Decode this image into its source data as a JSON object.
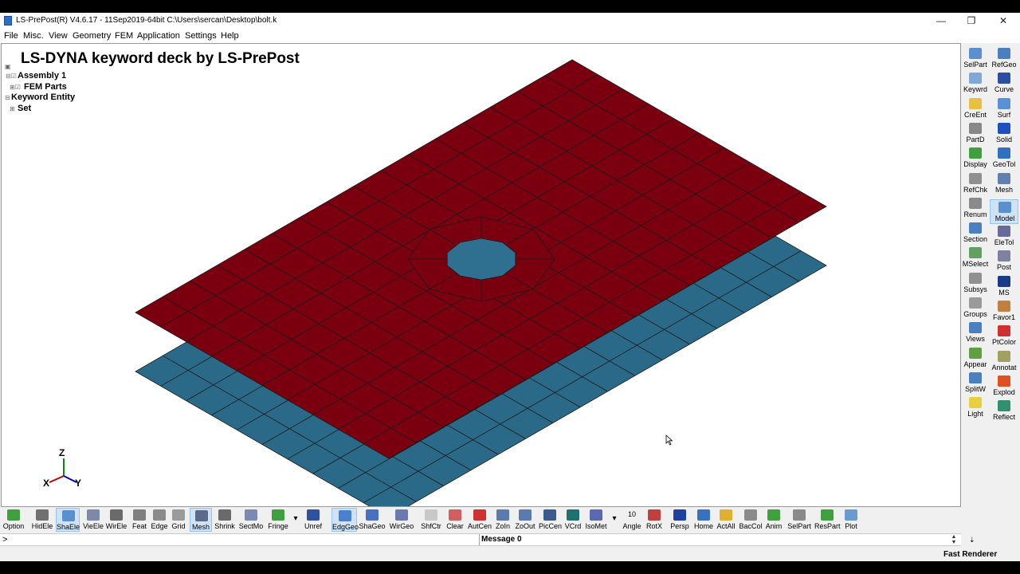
{
  "window": {
    "title": "LS-PrePost(R) V4.6.17 - 11Sep2019-64bit C:\\Users\\sercan\\Desktop\\bolt.k",
    "minimize_glyph": "—",
    "restore_glyph": "❐",
    "close_glyph": "✕"
  },
  "menu": [
    "File",
    "Misc.",
    "View",
    "Geometry",
    "FEM",
    "Application",
    "Settings",
    "Help"
  ],
  "viewport": {
    "title": "LS-DYNA keyword deck by LS-PrePost",
    "tree": [
      {
        "label": "Assembly 1"
      },
      {
        "label": "FEM Parts"
      },
      {
        "label": "Keyword Entity"
      },
      {
        "label": "Set"
      }
    ],
    "triad": {
      "z": "Z",
      "x": "X",
      "y": "Y"
    },
    "colors": {
      "top_plate": "#7a0010",
      "bottom_plate": "#2a6a88",
      "hole": "#2f7090",
      "mesh_line": "#1a1a1a"
    }
  },
  "right_panel": [
    {
      "label": "SelPart",
      "icon": "select-part-icon",
      "color": "#5a8fd0"
    },
    {
      "label": "RefGeo",
      "icon": "ref-geo-icon",
      "color": "#4a7fc0"
    },
    {
      "label": "Keywrd",
      "icon": "keyword-icon",
      "color": "#7fa7d8"
    },
    {
      "label": "Curve",
      "icon": "curve-icon",
      "color": "#2a4fa0"
    },
    {
      "label": "CreEnt",
      "icon": "create-entity-icon",
      "color": "#e8c040"
    },
    {
      "label": "Surf",
      "icon": "surface-icon",
      "color": "#5a90d8"
    },
    {
      "label": "PartD",
      "icon": "part-data-icon",
      "color": "#888888"
    },
    {
      "label": "Solid",
      "icon": "solid-icon",
      "color": "#2050c0"
    },
    {
      "label": "Display",
      "icon": "display-icon",
      "color": "#40a040"
    },
    {
      "label": "GeoTol",
      "icon": "geo-tool-icon",
      "color": "#3070c0"
    },
    {
      "label": "RefChk",
      "icon": "reference-check-icon",
      "color": "#909090"
    },
    {
      "label": "Mesh",
      "icon": "mesh-icon",
      "color": "#6080b0"
    },
    {
      "label": "Renum",
      "icon": "renumber-icon",
      "color": "#8a8a8a"
    },
    {
      "label": "Model",
      "icon": "model-icon",
      "color": "#5a8fd0"
    },
    {
      "label": "Section",
      "icon": "section-icon",
      "color": "#4a80c0"
    },
    {
      "label": "EleTol",
      "icon": "element-tool-icon",
      "color": "#6a6a9a"
    },
    {
      "label": "MSelect",
      "icon": "multi-select-icon",
      "color": "#60a060"
    },
    {
      "label": "Post",
      "icon": "post-icon",
      "color": "#8080a0"
    },
    {
      "label": "Subsys",
      "icon": "subsystem-icon",
      "color": "#909090"
    },
    {
      "label": "MS",
      "icon": "ms-icon",
      "color": "#1a3a8a"
    },
    {
      "label": "Groups",
      "icon": "groups-icon",
      "color": "#9a9a9a"
    },
    {
      "label": "Favor1",
      "icon": "favorite-icon",
      "color": "#c08040"
    },
    {
      "label": "Views",
      "icon": "views-icon",
      "color": "#4a7fc0"
    },
    {
      "label": "PtColor",
      "icon": "part-color-icon",
      "color": "#d03030"
    },
    {
      "label": "Appear",
      "icon": "appearance-icon",
      "color": "#60a040"
    },
    {
      "label": "Annotat",
      "icon": "annotation-icon",
      "color": "#a0a060"
    },
    {
      "label": "SplitW",
      "icon": "split-window-icon",
      "color": "#4a7fc0"
    },
    {
      "label": "Explod",
      "icon": "explode-icon",
      "color": "#e05020"
    },
    {
      "label": "Light",
      "icon": "light-icon",
      "color": "#e8d040"
    },
    {
      "label": "Reflect",
      "icon": "reflect-icon",
      "color": "#309070"
    }
  ],
  "right_panel_more": "⇣",
  "bottom_toolbar": [
    {
      "label": "Option",
      "icon": "option-icon",
      "color": "#40a040"
    },
    {
      "label": "HidEle",
      "icon": "hide-element-icon",
      "color": "#707070"
    },
    {
      "label": "ShaEle",
      "icon": "shade-element-icon",
      "color": "#5a8fd0"
    },
    {
      "label": "VieEle",
      "icon": "view-element-icon",
      "color": "#7a8aa8"
    },
    {
      "label": "WirEle",
      "icon": "wire-element-icon",
      "color": "#6a6a6a"
    },
    {
      "label": "Feat",
      "icon": "feature-icon",
      "color": "#808080"
    },
    {
      "label": "Edge",
      "icon": "edge-icon",
      "color": "#8a8a8a"
    },
    {
      "label": "Grid",
      "icon": "grid-icon",
      "color": "#9a9a9a"
    },
    {
      "label": "Mesh",
      "icon": "mesh-icon",
      "color": "#5a6a8a"
    },
    {
      "label": "Shrink",
      "icon": "shrink-icon",
      "color": "#6a6a6a"
    },
    {
      "label": "SectMo",
      "icon": "section-model-icon",
      "color": "#7a8ab0"
    },
    {
      "label": "Fringe",
      "icon": "fringe-icon",
      "color": "#40a040"
    },
    {
      "label": "▾",
      "icon": "dropdown-arrow-icon",
      "color": "#f0f0f0"
    },
    {
      "label": "Unref",
      "icon": "unreferenced-icon",
      "color": "#3050a0"
    },
    {
      "label": "EdgGeo",
      "icon": "edge-geometry-icon",
      "color": "#4a80d0"
    },
    {
      "label": "ShaGeo",
      "icon": "shade-geometry-icon",
      "color": "#4a70c0"
    },
    {
      "label": "WirGeo",
      "icon": "wire-geometry-icon",
      "color": "#6a7ab0"
    },
    {
      "label": "ShfCtr",
      "icon": "shift-ctrl-icon",
      "color": "#c8c8c8"
    },
    {
      "label": "Clear",
      "icon": "clear-icon",
      "color": "#d06060"
    },
    {
      "label": "AutCen",
      "icon": "auto-center-icon",
      "color": "#d03030"
    },
    {
      "label": "ZoIn",
      "icon": "zoom-in-icon",
      "color": "#5a7ab0"
    },
    {
      "label": "ZoOut",
      "icon": "zoom-out-icon",
      "color": "#5a7ab0"
    },
    {
      "label": "PicCen",
      "icon": "pick-center-icon",
      "color": "#3a5a90"
    },
    {
      "label": "VCrd",
      "icon": "view-coordinate-icon",
      "color": "#207070"
    },
    {
      "label": "IsoMet",
      "icon": "isometric-icon",
      "color": "#5a6ab0"
    },
    {
      "label": "▾",
      "icon": "dropdown-arrow-icon",
      "color": "#f0f0f0"
    },
    {
      "label": "Angle",
      "icon": "angle-value-icon",
      "color": "#f0f0f0",
      "value": "10"
    },
    {
      "label": "RotX",
      "icon": "rotate-x-icon",
      "color": "#c04040"
    },
    {
      "label": "Persp",
      "icon": "perspective-icon",
      "color": "#2040a0"
    },
    {
      "label": "Home",
      "icon": "home-icon",
      "color": "#3a70c0"
    },
    {
      "label": "ActAll",
      "icon": "activate-all-icon",
      "color": "#e0b030"
    },
    {
      "label": "BacCol",
      "icon": "background-color-icon",
      "color": "#8a8a8a"
    },
    {
      "label": "Anim",
      "icon": "animation-icon",
      "color": "#40a040"
    },
    {
      "label": "SelPart",
      "icon": "select-part-icon",
      "color": "#8a8a8a"
    },
    {
      "label": "ResPart",
      "icon": "reset-part-icon",
      "color": "#40a040"
    },
    {
      "label": "Plot",
      "icon": "plot-icon",
      "color": "#6a9ad0"
    }
  ],
  "command": {
    "prompt": ">",
    "message": "Message 0",
    "spin_up": "▲",
    "spin_down": "▼"
  },
  "status": {
    "renderer": "Fast Renderer"
  }
}
